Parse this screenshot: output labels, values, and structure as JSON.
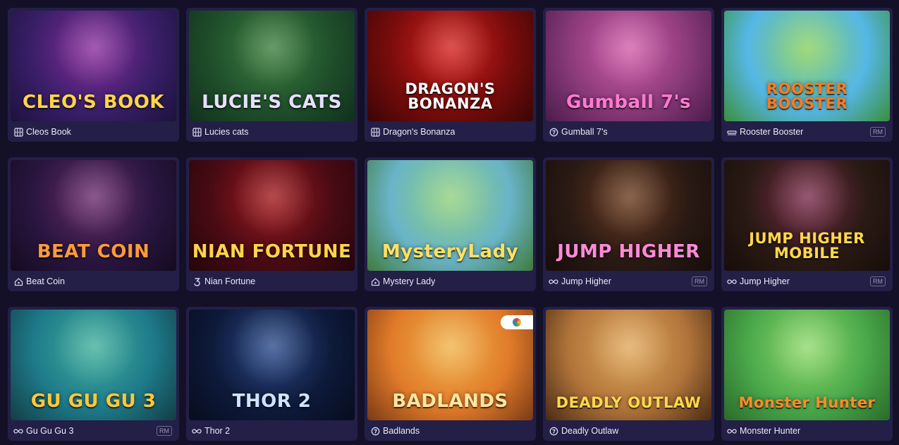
{
  "games": [
    {
      "title": "Cleos Book",
      "logo": "CLEO'S BOOK",
      "icon": "provider-slot-icon",
      "badge": "",
      "bg": [
        "#3b1f6a",
        "#8a2c9c",
        "#1c123e"
      ],
      "logo_color": "#ffd54a"
    },
    {
      "title": "Lucies cats",
      "logo": "LUCIE'S CATS",
      "icon": "provider-slot-icon",
      "badge": "",
      "bg": [
        "#1f4f2b",
        "#3d7e3e",
        "#11301d"
      ],
      "logo_color": "#e7e0ff"
    },
    {
      "title": "Dragon's Bonanza",
      "logo": "DRAGON'S BONANZA",
      "icon": "provider-slot-icon",
      "badge": "",
      "bg": [
        "#7a0c0c",
        "#d4221e",
        "#3a0505"
      ],
      "logo_color": "#ffffff"
    },
    {
      "title": "Gumball 7's",
      "logo": "Gumball 7's",
      "icon": "provider-circle-icon",
      "badge": "",
      "bg": [
        "#8a3a7a",
        "#d25ca8",
        "#4a1c4a"
      ],
      "logo_color": "#ff7ad1"
    },
    {
      "title": "Rooster Booster",
      "logo": "ROOSTER BOOSTER",
      "icon": "provider-bar-icon",
      "badge": "RM",
      "bg": [
        "#56b7e6",
        "#86cf5a",
        "#3a8f3a"
      ],
      "logo_color": "#ff7a1a"
    },
    {
      "title": "Beat Coin",
      "logo": "BEAT COIN",
      "icon": "provider-house-icon",
      "badge": "",
      "bg": [
        "#2a1640",
        "#6a2a6a",
        "#140a20"
      ],
      "logo_color": "#ff9a3a"
    },
    {
      "title": "Nian Fortune",
      "logo": "NIAN FORTUNE",
      "icon": "provider-three-icon",
      "badge": "",
      "bg": [
        "#4a0b14",
        "#a1181c",
        "#26050a"
      ],
      "logo_color": "#ffd44a"
    },
    {
      "title": "Mystery Lady",
      "logo": "MysteryLady",
      "icon": "provider-house-icon",
      "badge": "",
      "bg": [
        "#69b4c8",
        "#8fcf7a",
        "#3f7a3a"
      ],
      "logo_color": "#ffe066"
    },
    {
      "title": "Jump Higher",
      "logo": "JUMP HIGHER",
      "icon": "provider-infinity-icon",
      "badge": "RM",
      "bg": [
        "#2a1a14",
        "#6a3a1e",
        "#170d0a"
      ],
      "logo_color": "#ff8ad8"
    },
    {
      "title": "Jump Higher",
      "logo": "JUMP HIGHER MOBILE",
      "icon": "provider-infinity-icon",
      "badge": "RM",
      "bg": [
        "#2a1a14",
        "#7a2a4a",
        "#170d0a"
      ],
      "logo_color": "#ffd84a"
    },
    {
      "title": "Gu Gu Gu 3",
      "logo": "GU GU GU 3",
      "icon": "provider-infinity-icon",
      "badge": "RM",
      "bg": [
        "#1e7a8a",
        "#3fae9a",
        "#123d44"
      ],
      "logo_color": "#ffc83a"
    },
    {
      "title": "Thor 2",
      "logo": "THOR 2",
      "icon": "provider-infinity-icon",
      "badge": "",
      "bg": [
        "#0e1a3a",
        "#2a4a8a",
        "#070c1e"
      ],
      "logo_color": "#cfe3ff"
    },
    {
      "title": "Badlands",
      "logo": "BADLANDS",
      "icon": "provider-circle-icon",
      "badge": "",
      "bg": [
        "#e07a2a",
        "#f0b24a",
        "#7a3a14"
      ],
      "logo_color": "#ffe7a0",
      "chip": true
    },
    {
      "title": "Deadly Outlaw",
      "logo": "DEADLY OUTLAW",
      "icon": "provider-circle-icon",
      "badge": "",
      "bg": [
        "#b0743a",
        "#e0a85a",
        "#4a2a14"
      ],
      "logo_color": "#ffd84a"
    },
    {
      "title": "Monster Hunter",
      "logo": "Monster Hunter",
      "icon": "provider-infinity-icon",
      "badge": "",
      "bg": [
        "#4aa84a",
        "#8fd86a",
        "#2a6a2a"
      ],
      "logo_color": "#ff8a2a"
    }
  ]
}
